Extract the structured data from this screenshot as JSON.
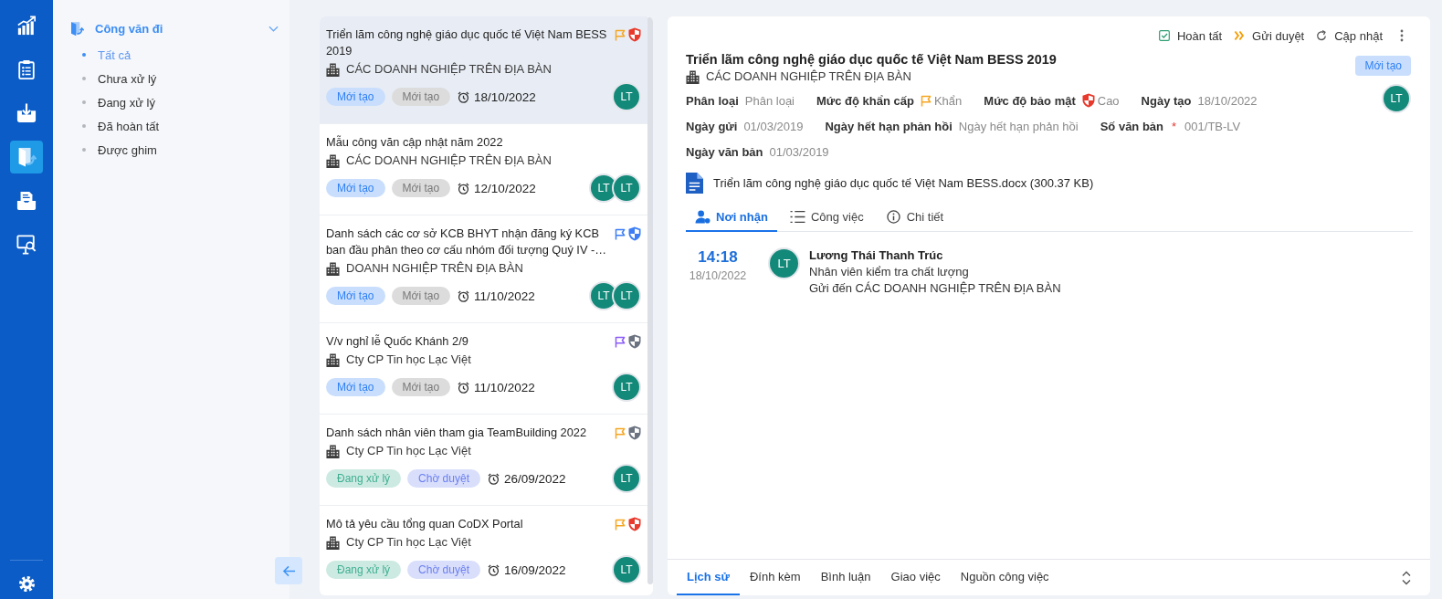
{
  "rail": {
    "items": [
      {
        "selected": false
      },
      {
        "selected": false
      },
      {
        "selected": false
      },
      {
        "selected": true
      },
      {
        "selected": false
      },
      {
        "selected": false
      }
    ]
  },
  "submenu": {
    "title": "Công văn đi",
    "expanded": true,
    "items": [
      {
        "label": "Tất cả",
        "selected": true
      },
      {
        "label": "Chưa xử lý",
        "selected": false
      },
      {
        "label": "Đang xử lý",
        "selected": false
      },
      {
        "label": "Đã hoàn tất",
        "selected": false
      },
      {
        "label": "Được ghim",
        "selected": false
      }
    ]
  },
  "list": {
    "items": [
      {
        "title": "Triển lãm công nghệ giáo dục quốc tế Việt Nam BESS 2019",
        "urgency": {
          "color": "#f5a623"
        },
        "security": {
          "color": "#e8392c"
        },
        "organization": "CÁC DOANH NGHIỆP TRÊN ĐỊA BÀN",
        "tags": [
          {
            "label": "Mới tạo",
            "color": "#2f80f5"
          },
          {
            "label": "Mới tạo",
            "color": "#777777"
          }
        ],
        "date": "18/10/2022",
        "avatars": [
          "LT"
        ],
        "selected": true
      },
      {
        "title": "Mẫu công văn cập nhật năm 2022",
        "organization": "CÁC DOANH NGHIỆP TRÊN ĐỊA BÀN",
        "tags": [
          {
            "label": "Mới tạo",
            "color": "#2f80f5"
          },
          {
            "label": "Mới tạo",
            "color": "#777777"
          }
        ],
        "date": "12/10/2022",
        "avatars": [
          "LT",
          "LT"
        ],
        "selected": false
      },
      {
        "title": "Danh sách các cơ sở KCB BHYT nhận đăng ký KCB ban đầu phân theo cơ cấu nhóm đối tượng Quý IV -…",
        "urgency": {
          "color": "#3d7ef5"
        },
        "security": {
          "color": "#3d7ef5"
        },
        "organization": "DOANH NGHIỆP TRÊN ĐỊA BÀN",
        "tags": [
          {
            "label": "Mới tạo",
            "color": "#2f80f5"
          },
          {
            "label": "Mới tạo",
            "color": "#777777"
          }
        ],
        "date": "11/10/2022",
        "avatars": [
          "LT",
          "LT"
        ],
        "selected": false
      },
      {
        "title": "V/v nghỉ lễ Quốc Khánh 2/9",
        "urgency": {
          "color": "#8b5cf6"
        },
        "security": {
          "color": "#6b7280"
        },
        "organization": "Cty CP Tin học Lạc Việt",
        "tags": [
          {
            "label": "Mới tạo",
            "color": "#2f80f5"
          },
          {
            "label": "Mới tạo",
            "color": "#777777"
          }
        ],
        "date": "11/10/2022",
        "avatars": [
          "LT"
        ],
        "selected": false
      },
      {
        "title": "Danh sách nhân viên tham gia TeamBuilding 2022",
        "urgency": {
          "color": "#f5a623"
        },
        "security": {
          "color": "#6b7280"
        },
        "organization": "Cty CP Tin học Lạc Việt",
        "tags": [
          {
            "label": "Đang xử lý",
            "color": "#3fae91"
          },
          {
            "label": "Chờ duyệt",
            "color": "#6b80f0"
          }
        ],
        "date": "26/09/2022",
        "avatars": [
          "LT"
        ],
        "selected": false
      },
      {
        "title": "Mô tả yêu cầu tổng quan CoDX Portal",
        "urgency": {
          "color": "#f5a623"
        },
        "security": {
          "color": "#e8392c"
        },
        "organization": "Cty CP Tin học Lạc Việt",
        "tags": [
          {
            "label": "Đang xử lý",
            "color": "#3fae91"
          },
          {
            "label": "Chờ duyệt",
            "color": "#6b80f0"
          }
        ],
        "date": "16/09/2022",
        "avatars": [
          "LT"
        ],
        "selected": false
      }
    ]
  },
  "detail": {
    "actions": [
      "Hoàn tất",
      "Gửi duyệt",
      "Cập nhật"
    ],
    "title": "Triển lãm công nghệ giáo dục quốc tế Việt Nam BESS 2019",
    "organization": "CÁC DOANH NGHIỆP TRÊN ĐỊA BÀN",
    "status": {
      "label": "Mới tạo",
      "color": "#2f80f5"
    },
    "avatar": "LT",
    "field_rows": [
      [
        {
          "kind": "text",
          "label": "Phân loại",
          "value": "Phân loại"
        },
        {
          "kind": "flag",
          "label": "Mức độ khẩn cấp",
          "value": "Khẩn",
          "color": "#f5a623"
        },
        {
          "kind": "shield",
          "label": "Mức độ bảo mật",
          "value": "Cao",
          "color": "#e8392c"
        },
        {
          "kind": "text",
          "label": "Ngày tạo",
          "value": "18/10/2022"
        }
      ],
      [
        {
          "kind": "text",
          "label": "Ngày gửi",
          "value": "01/03/2019"
        },
        {
          "kind": "text",
          "label": "Ngày hết hạn phản hồi",
          "value": "Ngày hết hạn phản hồi"
        },
        {
          "kind": "required",
          "label": "Số văn bản",
          "mark": "*",
          "value": "001/TB-LV"
        }
      ],
      [
        {
          "kind": "text",
          "label": "Ngày văn bản",
          "value": "01/03/2019"
        }
      ]
    ],
    "attachment": "Triển lãm công nghệ giáo dục quốc tế Việt Nam BESS.docx (300.37 KB)",
    "tabs": [
      {
        "label": "Nơi nhận",
        "selected": true
      },
      {
        "label": "Công việc",
        "selected": false
      },
      {
        "label": "Chi tiết",
        "selected": false
      }
    ],
    "recipients": [
      {
        "time": "14:18",
        "date": "18/10/2022",
        "avatar": "LT",
        "name": "Lương Thái Thanh Trúc",
        "role": "Nhân viên kiểm tra chất lượng",
        "sent_to": "Gửi đến CÁC DOANH NGHIỆP TRÊN ĐỊA BÀN"
      }
    ],
    "bottom_tabs": [
      {
        "label": "Lịch sử",
        "selected": true
      },
      {
        "label": "Đính kèm",
        "selected": false
      },
      {
        "label": "Bình luận",
        "selected": false
      },
      {
        "label": "Giao việc",
        "selected": false
      },
      {
        "label": "Nguồn công việc",
        "selected": false
      }
    ]
  }
}
